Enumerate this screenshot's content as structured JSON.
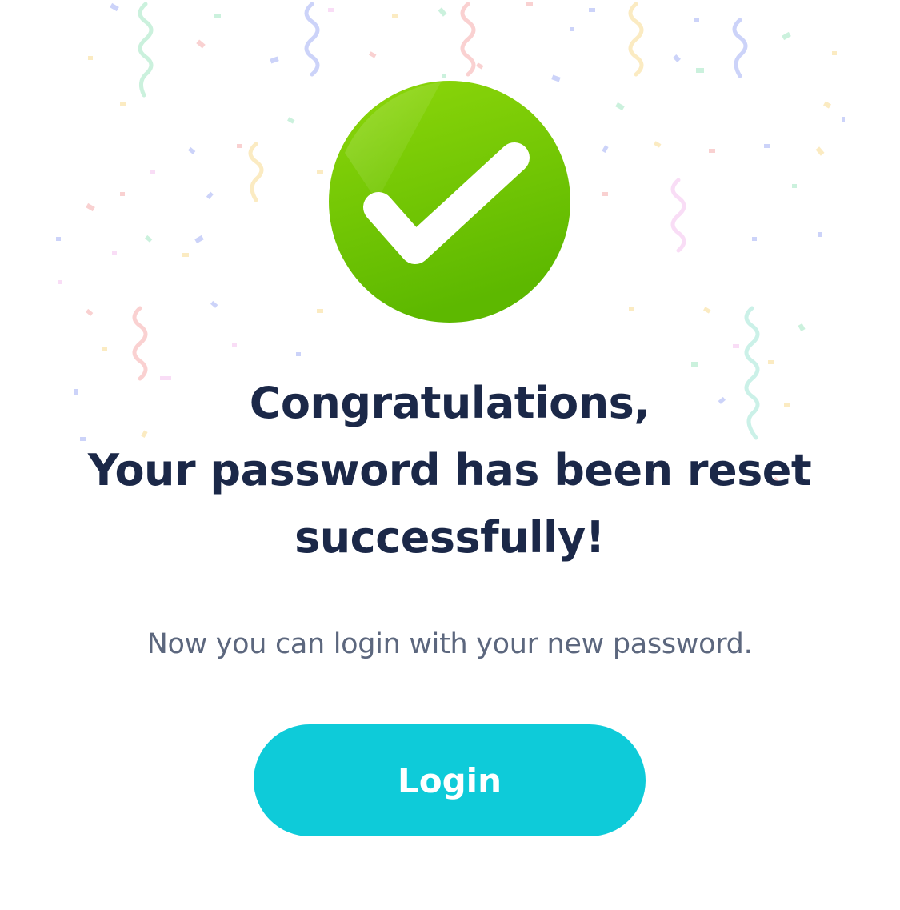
{
  "success": {
    "icon": "check-circle-icon",
    "heading_line1": "Congratulations,",
    "heading_line2": "Your password has been reset",
    "heading_line3": "successfully!",
    "message": "Now you can login with your new password.",
    "login_label": "Login"
  },
  "colors": {
    "background": "#ffffff",
    "heading": "#1b2848",
    "message": "#5c677e",
    "button": "#0ecbd9",
    "check_green": "#6cc00a"
  },
  "decoration": "confetti-icon"
}
